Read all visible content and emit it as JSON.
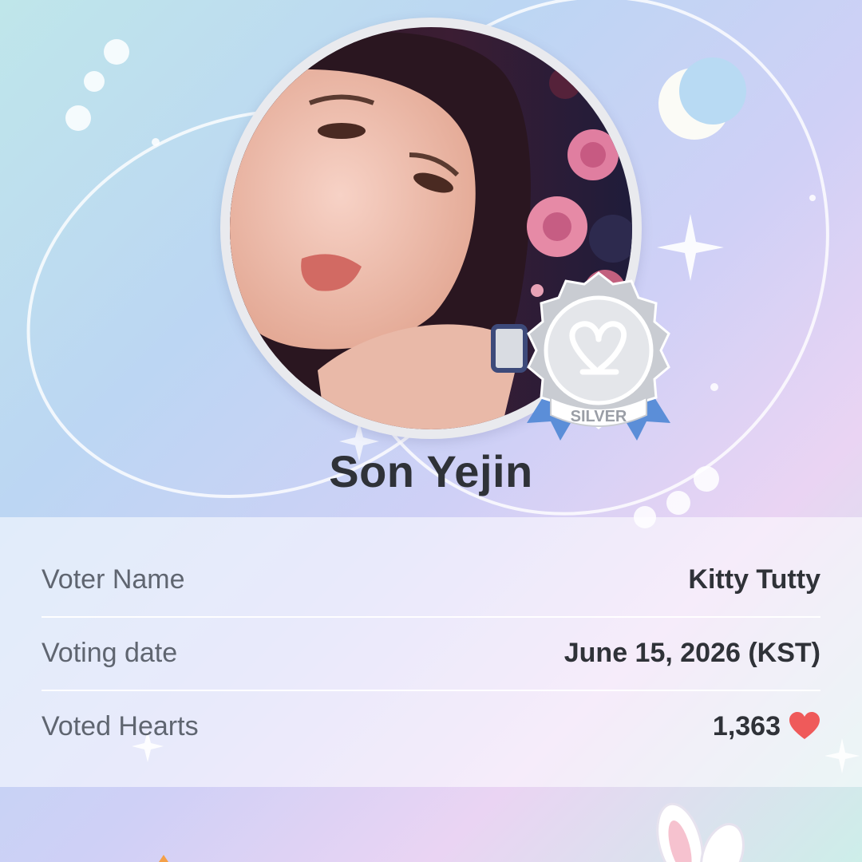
{
  "artist": {
    "name": "Son Yejin"
  },
  "badge": {
    "tier_label": "SILVER",
    "icon": "heart-loop-logo-icon"
  },
  "info": {
    "voter_name_label": "Voter Name",
    "voter_name_value": "Kitty Tutty",
    "voting_date_label": "Voting date",
    "voting_date_value": "June 15, 2026 (KST)",
    "voted_hearts_label": "Voted Hearts",
    "voted_hearts_value": "1,363"
  },
  "icons": {
    "hearts": "heart-icon",
    "moon": "crescent-moon-icon",
    "sparkle": "sparkle-icon"
  },
  "colors": {
    "heart": "#ef5a5a",
    "ribbon": "#5b8ed8",
    "silver": "#c9ccd2",
    "text_dark": "#2f3238",
    "text_label": "#5f6570"
  }
}
